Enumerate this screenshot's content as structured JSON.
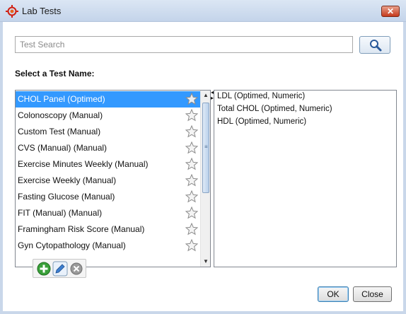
{
  "window": {
    "title": "Lab Tests",
    "close_label": "✕"
  },
  "search": {
    "placeholder": "Test Search",
    "value": ""
  },
  "section_label": "Select a Test Name:",
  "tests": [
    {
      "label": "CHOL Panel (Optimed)",
      "selected": true
    },
    {
      "label": "Colonoscopy (Manual)",
      "selected": false
    },
    {
      "label": "Custom Test (Manual)",
      "selected": false
    },
    {
      "label": "CVS (Manual) (Manual)",
      "selected": false
    },
    {
      "label": "Exercise Minutes Weekly (Manual)",
      "selected": false
    },
    {
      "label": "Exercise Weekly (Manual)",
      "selected": false
    },
    {
      "label": "Fasting Glucose (Manual)",
      "selected": false
    },
    {
      "label": "FIT (Manual) (Manual)",
      "selected": false
    },
    {
      "label": "Framingham Risk Score (Manual)",
      "selected": false
    },
    {
      "label": "Gyn Cytopathology (Manual)",
      "selected": false
    }
  ],
  "details": [
    "LDL (Optimed, Numeric)",
    "Total CHOL (Optimed, Numeric)",
    "HDL (Optimed, Numeric)"
  ],
  "buttons": {
    "ok": "OK",
    "close": "Close"
  },
  "colors": {
    "selection": "#3399ff",
    "titlebar": "#c4d4ea"
  }
}
